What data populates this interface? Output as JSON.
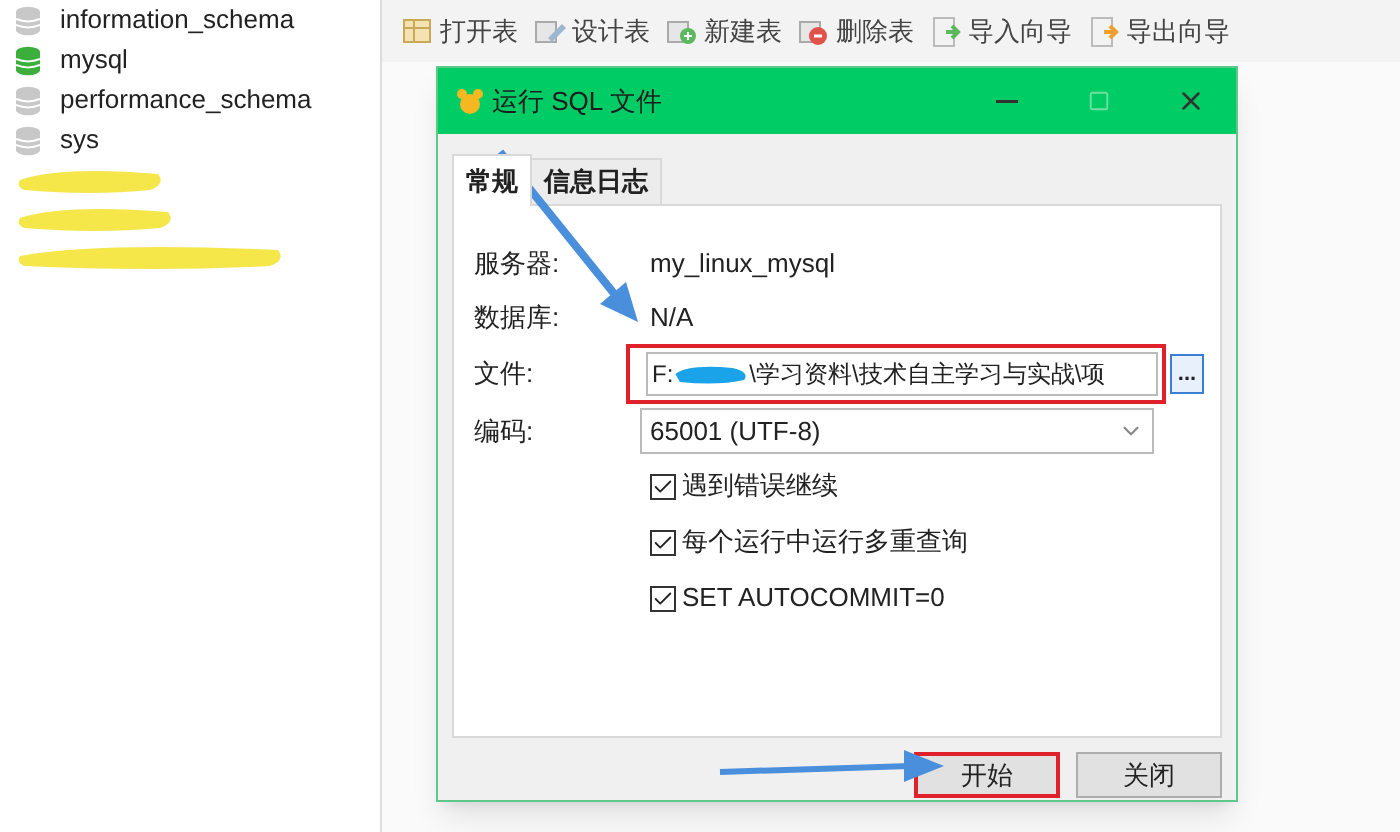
{
  "sidebar": {
    "items": [
      {
        "kind": "database",
        "label": "information_schema",
        "open": false
      },
      {
        "kind": "database",
        "label": "mysql",
        "open": true
      },
      {
        "kind": "database",
        "label": "performance_schema",
        "open": false
      },
      {
        "kind": "database",
        "label": "sys",
        "open": false
      },
      {
        "kind": "redacted"
      },
      {
        "kind": "redacted"
      },
      {
        "kind": "redacted"
      }
    ]
  },
  "toolbar": [
    {
      "kind": "open",
      "label": "打开表"
    },
    {
      "kind": "design",
      "label": "设计表"
    },
    {
      "kind": "new",
      "label": "新建表"
    },
    {
      "kind": "delete",
      "label": "删除表"
    },
    {
      "kind": "import",
      "label": "导入向导"
    },
    {
      "kind": "export",
      "label": "导出向导"
    }
  ],
  "dialog": {
    "title": "运行 SQL 文件",
    "tabs": [
      {
        "label": "常规",
        "selected": true
      },
      {
        "label": "信息日志",
        "selected": false
      }
    ],
    "server": {
      "label": "服务器:",
      "value": "my_linux_mysql"
    },
    "database": {
      "label": "数据库:",
      "value": "N/A"
    },
    "file": {
      "label": "文件:",
      "value_start": "F:",
      "value_end": "\\学习资料\\技术自主学习与实战\\项",
      "highlighted": true,
      "browse": "..."
    },
    "encoding": {
      "label": "编码:",
      "value": "65001 (UTF-8)"
    },
    "checkboxes": [
      {
        "label": "遇到错误继续",
        "checked": true
      },
      {
        "label": "每个运行中运行多重查询",
        "checked": true
      },
      {
        "label": "SET AUTOCOMMIT=0",
        "checked": true
      }
    ],
    "buttons": [
      {
        "label": "开始",
        "highlighted": true
      },
      {
        "label": "关闭",
        "highlighted": false
      }
    ]
  }
}
